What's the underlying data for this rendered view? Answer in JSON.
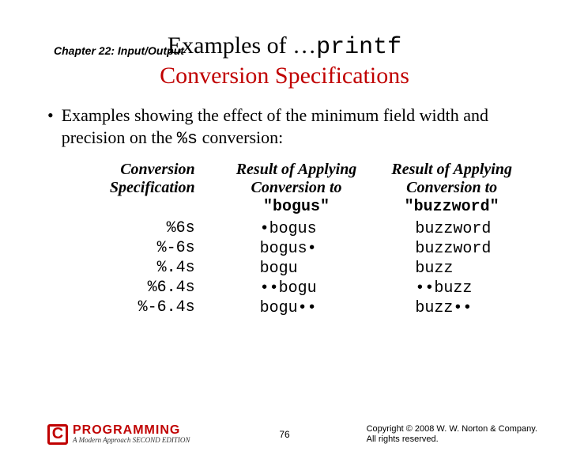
{
  "chapter": "Chapter 22: Input/Output",
  "title_line1_a": "Examples of …",
  "title_line1_b": "printf",
  "title_line2": "Conversion Specifications",
  "bullet_a": "Examples showing the effect of the minimum field width and precision on the ",
  "bullet_code": "%s",
  "bullet_b": " conversion:",
  "head1_a": "Conversion",
  "head1_b": "Specification",
  "head2_a": "Result of Applying",
  "head2_b": "Conversion to",
  "head2_c": "\"bogus\"",
  "head3_a": "Result of Applying",
  "head3_b": "Conversion to",
  "head3_c": "\"buzzword\"",
  "spec": [
    "%6s",
    "%-6s",
    "%.4s",
    "%6.4s",
    "%-6.4s"
  ],
  "res1": [
    "•bogus",
    "bogus•",
    "bogu",
    "••bogu",
    "bogu••"
  ],
  "res2": [
    "buzzword",
    "buzzword",
    "buzz",
    "••buzz",
    "buzz••"
  ],
  "page": "76",
  "logo_c": "C",
  "logo_prog": "PROGRAMMING",
  "logo_sub": "A Modern Approach   SECOND EDITION",
  "copy1": "Copyright © 2008 W. W. Norton & Company.",
  "copy2": "All rights reserved."
}
